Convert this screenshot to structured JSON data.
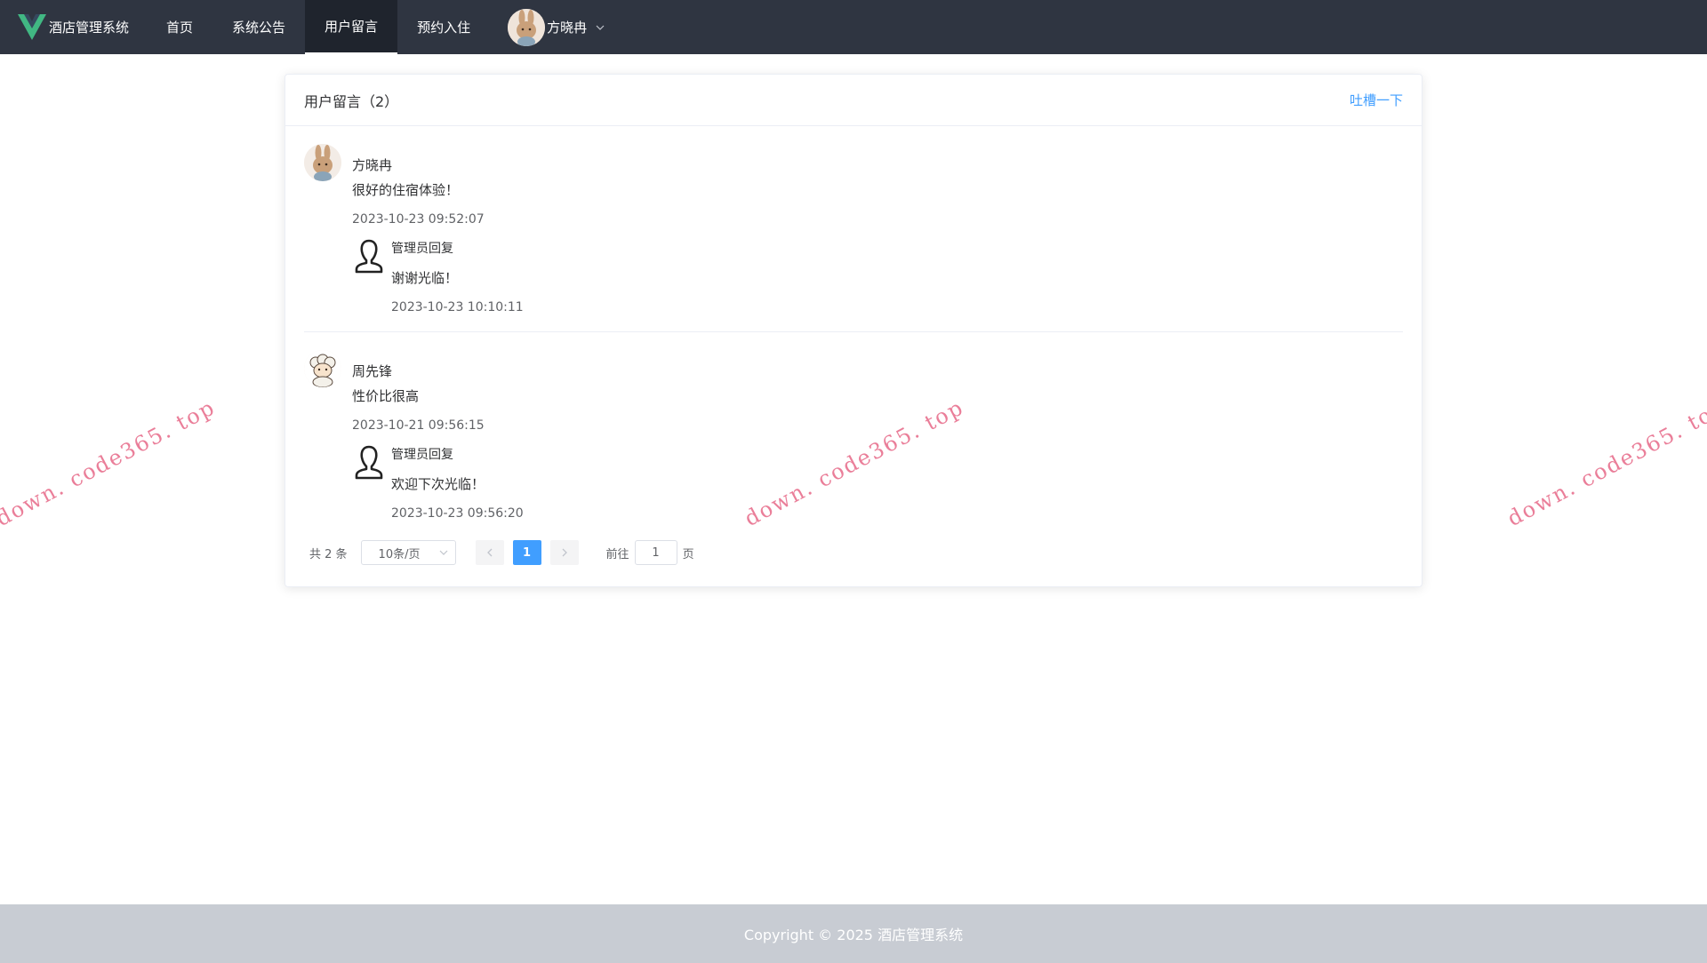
{
  "nav": {
    "brand": "酒店管理系统",
    "items": [
      "首页",
      "系统公告",
      "用户留言",
      "预约入住"
    ],
    "active_index": 2,
    "user_name": "方晓冉"
  },
  "card": {
    "title": "用户留言（2）",
    "action": "吐槽一下"
  },
  "messages": [
    {
      "name": "方晓冉",
      "text": "很好的住宿体验！",
      "time": "2023-10-23 09:52:07",
      "reply": {
        "name": "管理员回复",
        "text": "谢谢光临！",
        "time": "2023-10-23 10:10:11"
      }
    },
    {
      "name": "周先锋",
      "text": "性价比很高",
      "time": "2023-10-21 09:56:15",
      "reply": {
        "name": "管理员回复",
        "text": "欢迎下次光临！",
        "time": "2023-10-23 09:56:20"
      }
    }
  ],
  "pagination": {
    "total": "共 2 条",
    "page_size": "10条/页",
    "current_page": "1",
    "jump_prefix": "前往",
    "jump_value": "1",
    "jump_suffix": "页"
  },
  "footer": {
    "text": "Copyright © 2025 酒店管理系统"
  },
  "watermark": "down. code365. top",
  "colors": {
    "nav_bg": "#2f3541",
    "accent": "#409eff",
    "footer_bg": "#c8ccd3",
    "watermark": "#e8718e"
  },
  "icons": {
    "brand": "vue-logo-icon",
    "caret": "chevron-down-icon",
    "reply": "user-outline-icon",
    "prev": "chevron-left-icon",
    "next": "chevron-right-icon"
  }
}
